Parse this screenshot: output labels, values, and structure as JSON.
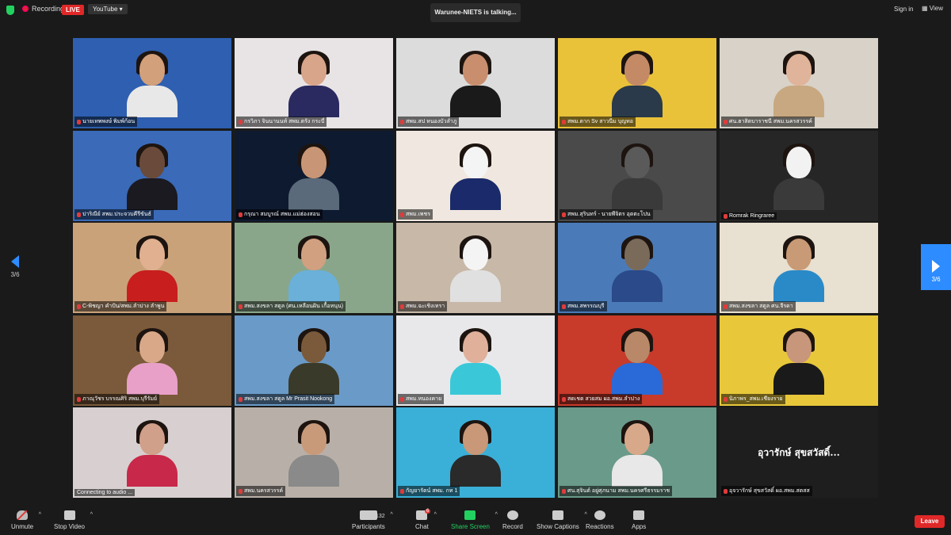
{
  "topbar": {
    "recording": "Recording",
    "live": "LIVE",
    "stream": "YouTube",
    "talking": "Warunee-NIETS is talking...",
    "signin": "Sign in",
    "view": "View"
  },
  "nav": {
    "left_page": "3/6",
    "right_page": "3/6"
  },
  "tiles": [
    {
      "label": "นายเทพพงษ์ พิมพ์ก้อน",
      "bg": "#2e5fb0",
      "skin": "#d2a07a",
      "shirt": "#e8e8e8"
    },
    {
      "label": "กรวิภา จินนานนท์ สพม.ตรัง กระบี่",
      "bg": "#e8e4e6",
      "skin": "#d8a48a",
      "shirt": "#2a2a60"
    },
    {
      "label": "สพม.สป หนองบัวลำภู",
      "bg": "#dcdcdc",
      "skin": "#c88e6e",
      "shirt": "#1a1a1a"
    },
    {
      "label": "สพม.ตาก Sv สาวนีม บุญทอ",
      "bg": "#e9c23a",
      "skin": "#c48a66",
      "shirt": "#2a3a4a"
    },
    {
      "label": "ศน.ฮาสิตบาราชนี สพม.นครสวรรค์",
      "bg": "#d8d2c8",
      "skin": "#e0b49a",
      "shirt": "#c8a880"
    },
    {
      "label": "ปาริณีย์ สพม.ประจวบคีรีขันธ์",
      "bg": "#3a6ab8",
      "skin": "#6a4a3a",
      "shirt": "#1a1a20"
    },
    {
      "label": "กรุณา สมบูรณ์ สพม.แม่ฮ่องสอน",
      "bg": "#0e1a30",
      "skin": "#c89676",
      "shirt": "#5a6a7a"
    },
    {
      "label": "สพม.เพชร",
      "bg": "#f0e8e0",
      "skin": "#f4f4f4",
      "shirt": "#1a2a6a"
    },
    {
      "label": "สพม.สุรินทร์ - นายพีจิตร อุดตะโปน",
      "bg": "#4a4a4a",
      "skin": "#5a5a5a",
      "shirt": "#3a3a3a"
    },
    {
      "label": "Romrak Ringraree",
      "bg": "#262626",
      "skin": "#f2f2f2",
      "shirt": "#3a3a3a"
    },
    {
      "label": "C-พิชญา คำปัน/สพม.ลำปาง ลำพูน",
      "bg": "#caa27a",
      "skin": "#e0b090",
      "shirt": "#c81e1e"
    },
    {
      "label": "สพม.สงขลา สตูล (ศน.เหลือนฝัน เกื้อหนุน)",
      "bg": "#8aa68a",
      "skin": "#d0a080",
      "shirt": "#6ab0d8"
    },
    {
      "label": "สพม.ฉะเชิงเทรา",
      "bg": "#c8b8a8",
      "skin": "#f4f4f4",
      "shirt": "#e0e0e0"
    },
    {
      "label": "สพม.สพรรณบุรี",
      "bg": "#4a7ab8",
      "skin": "#7a6a5a",
      "shirt": "#2a4a8a"
    },
    {
      "label": "สพม.สงขลา สตูล ศน.จีรดา",
      "bg": "#e8e0d0",
      "skin": "#c89a76",
      "shirt": "#2a8ac8"
    },
    {
      "label": "ภาณุวัชร บรรณศิริ สพม.บุรีรัมย์",
      "bg": "#7a5a3a",
      "skin": "#d8a888",
      "shirt": "#e8a0c8"
    },
    {
      "label": "สพม.สงขลา สตูล Mr Prasit Nookong",
      "bg": "#6a9ac8",
      "skin": "#7a5a3a",
      "shirt": "#3a3a2a"
    },
    {
      "label": "สพม.หนองคาย",
      "bg": "#e8e8ea",
      "skin": "#e0b09a",
      "shirt": "#3ac8d8"
    },
    {
      "label": "สดเชต สวยสม ผอ.สพม.ลำปาง",
      "bg": "#c83a2a",
      "skin": "#b88868",
      "shirt": "#2a6ad8"
    },
    {
      "label": "นิภาพร_สพม.เชียงราย",
      "bg": "#e8c83a",
      "skin": "#c8967a",
      "shirt": "#1a1a1a"
    },
    {
      "label": "Connecting to audio ...",
      "bg": "#d8d0d0",
      "skin": "#d0a08a",
      "shirt": "#c8284a"
    },
    {
      "label": "สพม.นครสวรรค์",
      "bg": "#b8b0a8",
      "skin": "#c89a7a",
      "shirt": "#8a8a8a"
    },
    {
      "label": "กัญยารัตน์ สพม. กท 1",
      "bg": "#3ab0d8",
      "skin": "#c89878",
      "shirt": "#2a2a2a"
    },
    {
      "label": "ศน.สุจินต์ อยู่ศุภนาม สพม.นครศรีธรรมราช",
      "bg": "#6a9a8a",
      "skin": "#d8a88a",
      "shirt": "#e8e8e8"
    },
    {
      "label": "อุจวารักษ์ สุขสวัสดิ์ ผอ.สพม.สตสส",
      "big": "อุวารักษ์ สุขสวัสดิ์..."
    }
  ],
  "toolbar": {
    "unmute": "Unmute",
    "stop_video": "Stop Video",
    "participants": "Participants",
    "participants_count": "132",
    "chat": "Chat",
    "chat_badge": "6",
    "share": "Share Screen",
    "record": "Record",
    "captions": "Show Captions",
    "reactions": "Reactions",
    "apps": "Apps",
    "leave": "Leave"
  }
}
